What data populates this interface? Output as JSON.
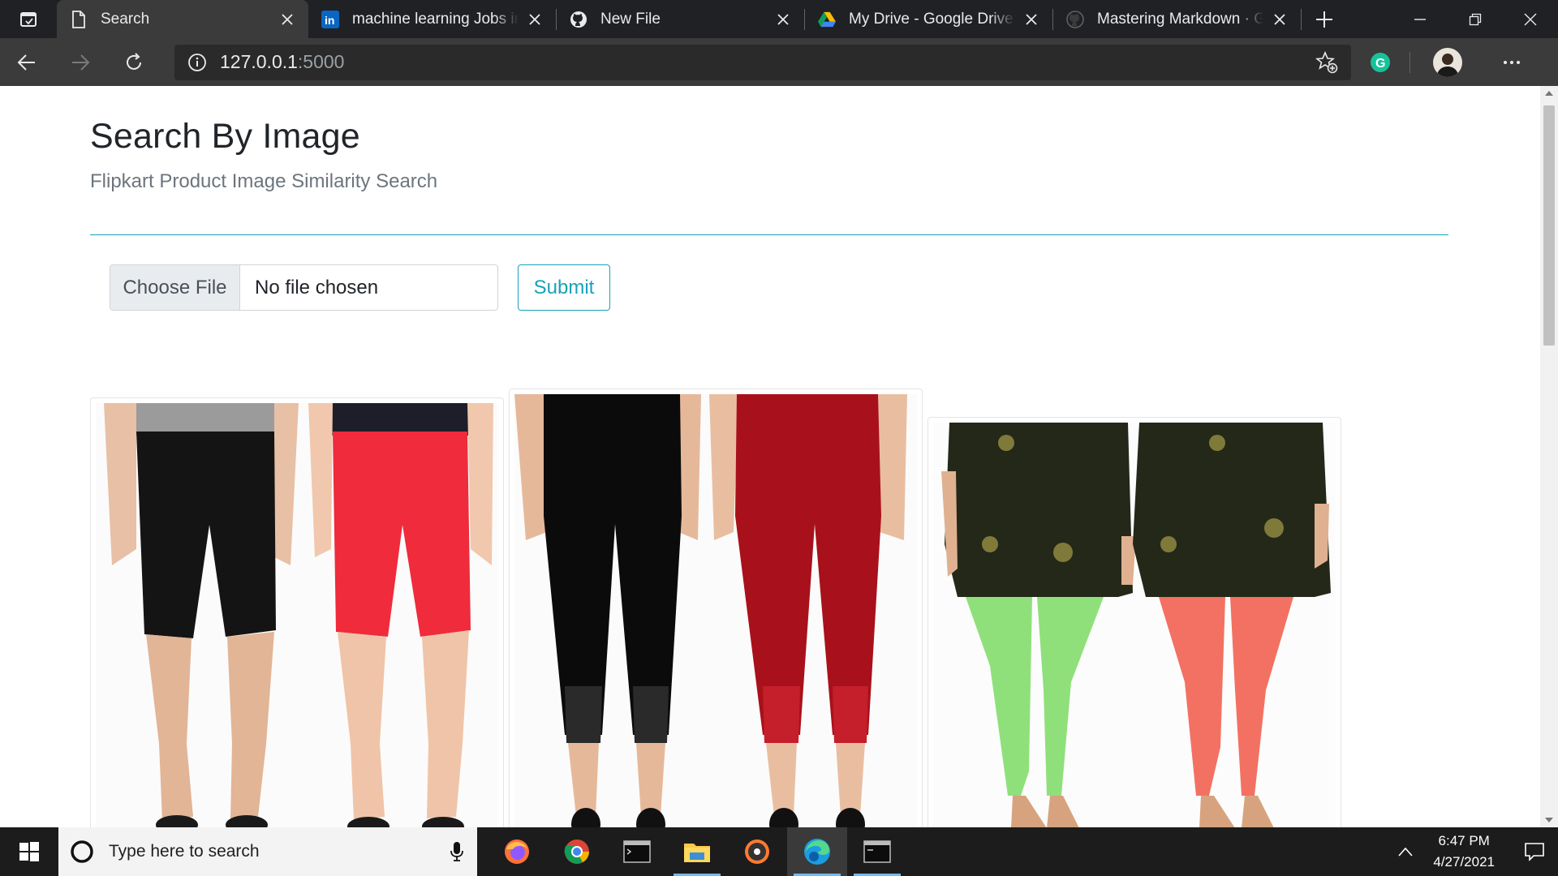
{
  "browser": {
    "tabs": [
      {
        "label": "Search",
        "icon": "page-icon",
        "active": true
      },
      {
        "label": "machine learning Jobs in I",
        "icon": "linkedin-icon",
        "active": false
      },
      {
        "label": "New File",
        "icon": "github-icon",
        "active": false
      },
      {
        "label": "My Drive - Google Drive",
        "icon": "google-drive-icon",
        "active": false
      },
      {
        "label": "Mastering Markdown · Git",
        "icon": "github-icon",
        "active": false
      }
    ],
    "address": {
      "host": "127.0.0.1",
      "port": ":5000"
    },
    "extension_letter": "G"
  },
  "page": {
    "title": "Search By Image",
    "subtitle": "Flipkart Product Image Similarity Search",
    "file_button": "Choose File",
    "file_status": "No file chosen",
    "submit": "Submit",
    "accent": "#17a2b8"
  },
  "results": [
    {
      "name": "result-card-1",
      "colors": [
        "#141414",
        "#ef2b3c"
      ],
      "style": "shorts"
    },
    {
      "name": "result-card-2",
      "colors": [
        "#0b0b0b",
        "#a8111b"
      ],
      "style": "capri"
    },
    {
      "name": "result-card-3",
      "colors": [
        "#8fe07a",
        "#f37162"
      ],
      "style": "churidar"
    }
  ],
  "taskbar": {
    "search_placeholder": "Type here to search",
    "apps": [
      "firefox-icon",
      "chrome-icon",
      "terminal-icon",
      "file-explorer-icon",
      "music-player-icon",
      "edge-icon",
      "command-prompt-icon"
    ],
    "time": "6:47 PM",
    "date": "4/27/2021"
  }
}
